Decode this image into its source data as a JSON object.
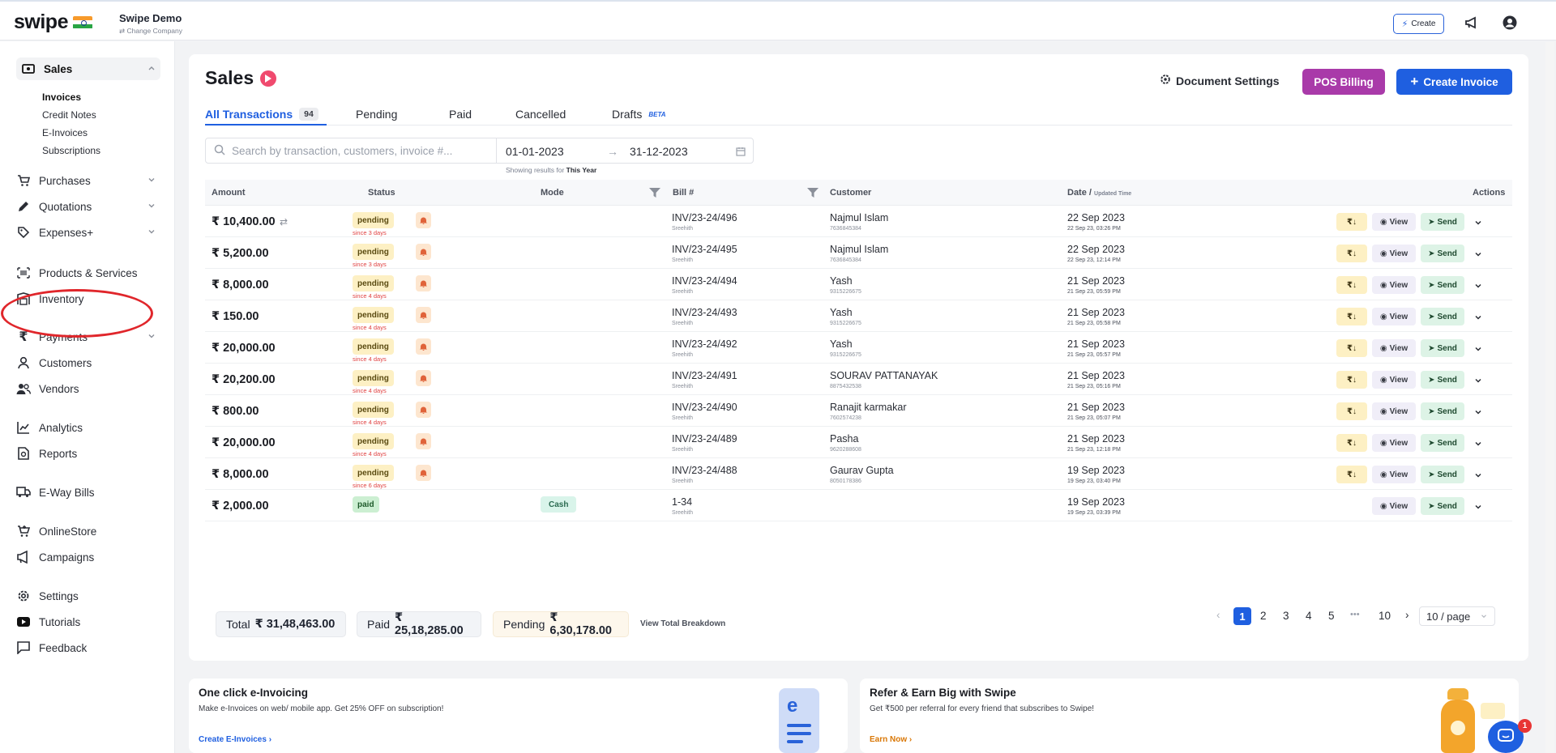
{
  "topbar": {
    "logo": "swipe",
    "company_name": "Swipe Demo",
    "change_company": "⇄ Change Company",
    "create_label": "Create"
  },
  "sidebar": {
    "sales": "Sales",
    "sales_sub": [
      "Invoices",
      "Credit Notes",
      "E-Invoices",
      "Subscriptions"
    ],
    "purchases": "Purchases",
    "quotations": "Quotations",
    "expenses": "Expenses+",
    "products": "Products & Services",
    "inventory": "Inventory",
    "payments": "Payments",
    "customers": "Customers",
    "vendors": "Vendors",
    "analytics": "Analytics",
    "reports": "Reports",
    "eway": "E-Way Bills",
    "onlinestore": "OnlineStore",
    "campaigns": "Campaigns",
    "settings": "Settings",
    "tutorials": "Tutorials",
    "feedback": "Feedback"
  },
  "header": {
    "title": "Sales",
    "document_settings": "Document Settings",
    "pos_billing": "POS Billing",
    "create_invoice": "Create Invoice"
  },
  "tabs": {
    "all": "All Transactions",
    "all_count": "94",
    "pending": "Pending",
    "paid": "Paid",
    "cancelled": "Cancelled",
    "drafts": "Drafts",
    "beta": "BETA"
  },
  "filters": {
    "search_placeholder": "Search by transaction, customers, invoice #...",
    "date_from": "01-01-2023",
    "date_to": "31-12-2023",
    "showing_prefix": "Showing results for",
    "showing_value": "This Year"
  },
  "table": {
    "headers": {
      "amount": "Amount",
      "status": "Status",
      "mode": "Mode",
      "bill": "Bill #",
      "customer": "Customer",
      "date": "Date /",
      "date_small": "Updated Time",
      "actions": "Actions"
    },
    "rows": [
      {
        "amount": "₹ 10,400.00",
        "status": "pending",
        "since": "since 3 days",
        "mode": "",
        "bill": "INV/23-24/496",
        "bill_sub": "Sreehith",
        "customer": "Najmul Islam",
        "phone": "7636845384",
        "date": "22 Sep 2023",
        "time": "22 Sep 23, 03:26 PM"
      },
      {
        "amount": "₹ 5,200.00",
        "status": "pending",
        "since": "since 3 days",
        "mode": "",
        "bill": "INV/23-24/495",
        "bill_sub": "Sreehith",
        "customer": "Najmul Islam",
        "phone": "7636845384",
        "date": "22 Sep 2023",
        "time": "22 Sep 23, 12:14 PM"
      },
      {
        "amount": "₹ 8,000.00",
        "status": "pending",
        "since": "since 4 days",
        "mode": "",
        "bill": "INV/23-24/494",
        "bill_sub": "Sreehith",
        "customer": "Yash",
        "phone": "9315226675",
        "date": "21 Sep 2023",
        "time": "21 Sep 23, 05:59 PM"
      },
      {
        "amount": "₹ 150.00",
        "status": "pending",
        "since": "since 4 days",
        "mode": "",
        "bill": "INV/23-24/493",
        "bill_sub": "Sreehith",
        "customer": "Yash",
        "phone": "9315226675",
        "date": "21 Sep 2023",
        "time": "21 Sep 23, 05:58 PM"
      },
      {
        "amount": "₹ 20,000.00",
        "status": "pending",
        "since": "since 4 days",
        "mode": "",
        "bill": "INV/23-24/492",
        "bill_sub": "Sreehith",
        "customer": "Yash",
        "phone": "9315226675",
        "date": "21 Sep 2023",
        "time": "21 Sep 23, 05:57 PM"
      },
      {
        "amount": "₹ 20,200.00",
        "status": "pending",
        "since": "since 4 days",
        "mode": "",
        "bill": "INV/23-24/491",
        "bill_sub": "Sreehith",
        "customer": "SOURAV PATTANAYAK",
        "phone": "8875432538",
        "date": "21 Sep 2023",
        "time": "21 Sep 23, 05:16 PM"
      },
      {
        "amount": "₹ 800.00",
        "status": "pending",
        "since": "since 4 days",
        "mode": "",
        "bill": "INV/23-24/490",
        "bill_sub": "Sreehith",
        "customer": "Ranajit karmakar",
        "phone": "7602574238",
        "date": "21 Sep 2023",
        "time": "21 Sep 23, 05:07 PM"
      },
      {
        "amount": "₹ 20,000.00",
        "status": "pending",
        "since": "since 4 days",
        "mode": "",
        "bill": "INV/23-24/489",
        "bill_sub": "Sreehith",
        "customer": "Pasha",
        "phone": "9620288608",
        "date": "21 Sep 2023",
        "time": "21 Sep 23, 12:18 PM"
      },
      {
        "amount": "₹ 8,000.00",
        "status": "pending",
        "since": "since 6 days",
        "mode": "",
        "bill": "INV/23-24/488",
        "bill_sub": "Sreehith",
        "customer": "Gaurav Gupta",
        "phone": "8050178386",
        "date": "19 Sep 2023",
        "time": "19 Sep 23, 03:40 PM"
      },
      {
        "amount": "₹ 2,000.00",
        "status": "paid",
        "since": "",
        "mode": "Cash",
        "bill": "1-34",
        "bill_sub": "Sreehith",
        "customer": "",
        "phone": "",
        "date": "19 Sep 2023",
        "time": "19 Sep 23, 03:39 PM"
      }
    ],
    "view_label": "View",
    "send_label": "Send",
    "rs_label": "₹↓"
  },
  "summary": {
    "total_label": "Total",
    "total_value": "₹ 31,48,463.00",
    "paid_label": "Paid",
    "paid_value": "₹ 25,18,285.00",
    "pending_label": "Pending",
    "pending_value": "₹ 6,30,178.00",
    "breakdown": "View Total Breakdown"
  },
  "pagination": {
    "pages": [
      "1",
      "2",
      "3",
      "4",
      "5"
    ],
    "ellipsis": "•••",
    "last": "10",
    "page_size": "10 / page"
  },
  "cards": {
    "einv_title": "One click e-Invoicing",
    "einv_desc": "Make e-Invoices on web/ mobile app. Get 25% OFF on subscription!",
    "einv_link": "Create E-Invoices ›",
    "refer_title": "Refer & Earn Big with Swipe",
    "refer_desc": "Get ₹500 per referral for every friend that subscribes to Swipe!",
    "refer_link": "Earn Now ›"
  },
  "chat_badge": "1",
  "colors": {
    "primary": "#1f5fe0",
    "pos": "#a93aa9",
    "annotation": "#e0262b"
  }
}
